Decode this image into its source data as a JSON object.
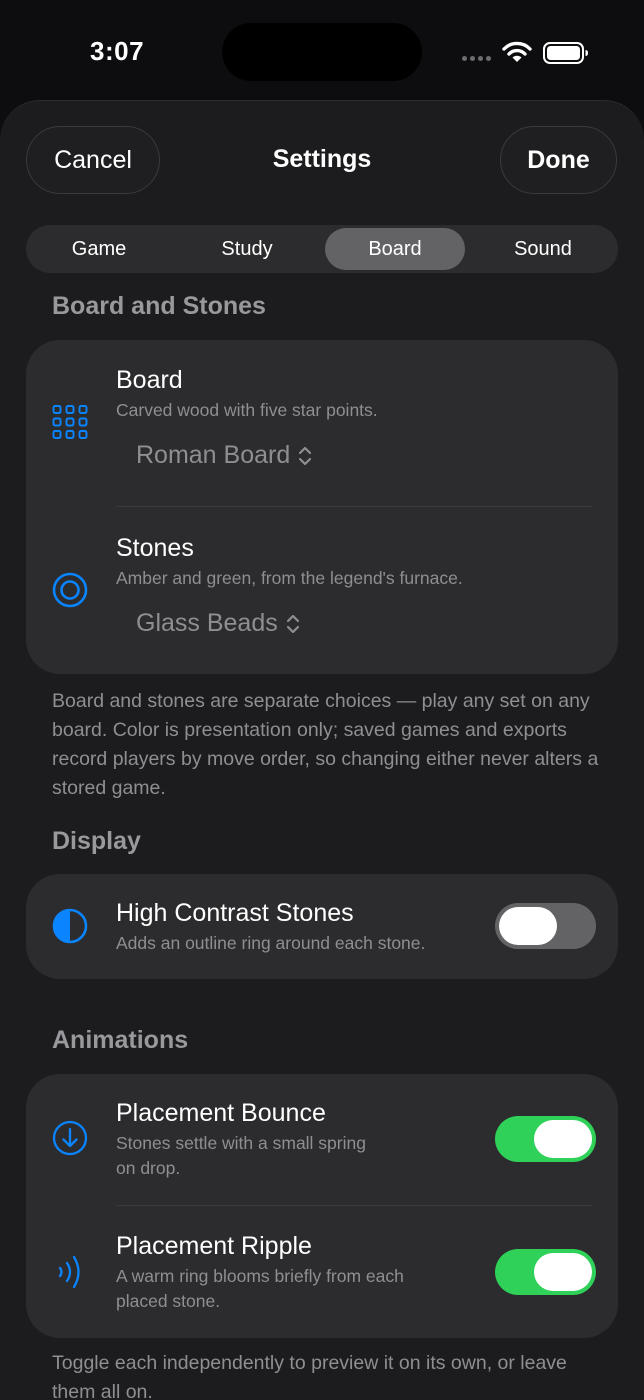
{
  "status_bar": {
    "time": "3:07"
  },
  "header": {
    "cancel_label": "Cancel",
    "title": "Settings",
    "done_label": "Done"
  },
  "tabs": [
    {
      "label": "Game",
      "selected": false
    },
    {
      "label": "Study",
      "selected": false
    },
    {
      "label": "Board",
      "selected": true
    },
    {
      "label": "Sound",
      "selected": false
    }
  ],
  "board_section": {
    "title": "Board and Stones",
    "board": {
      "icon": "grid-icon",
      "title": "Board",
      "subtitle": "Carved wood with five star points.",
      "value": "Roman Board"
    },
    "stones": {
      "icon": "target-circle-icon",
      "title": "Stones",
      "subtitle": "Amber and green, from the legend's furnace.",
      "value": "Glass Beads"
    },
    "footnote": "Board and stones are separate choices — play any set on any board. Color is presentation only; saved games and exports record players by move order, so changing either never alters a stored game."
  },
  "display_section": {
    "title": "Display",
    "high_contrast": {
      "icon": "contrast-icon",
      "title": "High Contrast Stones",
      "subtitle": "Adds an outline ring around each stone.",
      "enabled": false
    }
  },
  "animations_section": {
    "title": "Animations",
    "bounce": {
      "icon": "arrow-down-circle-icon",
      "title": "Placement Bounce",
      "subtitle_line1": "Stones settle with a small spring",
      "subtitle_line2": "on drop.",
      "enabled": true
    },
    "ripple": {
      "icon": "ripple-waves-icon",
      "title": "Placement Ripple",
      "subtitle_line1": "A warm ring blooms briefly from each",
      "subtitle_line2": "placed stone.",
      "enabled": true
    },
    "footnote": "Toggle each independently to preview it on its own, or leave them all on."
  },
  "colors": {
    "accent": "#0a84ff",
    "toggle_on": "#30d158",
    "toggle_off": "#636366"
  }
}
